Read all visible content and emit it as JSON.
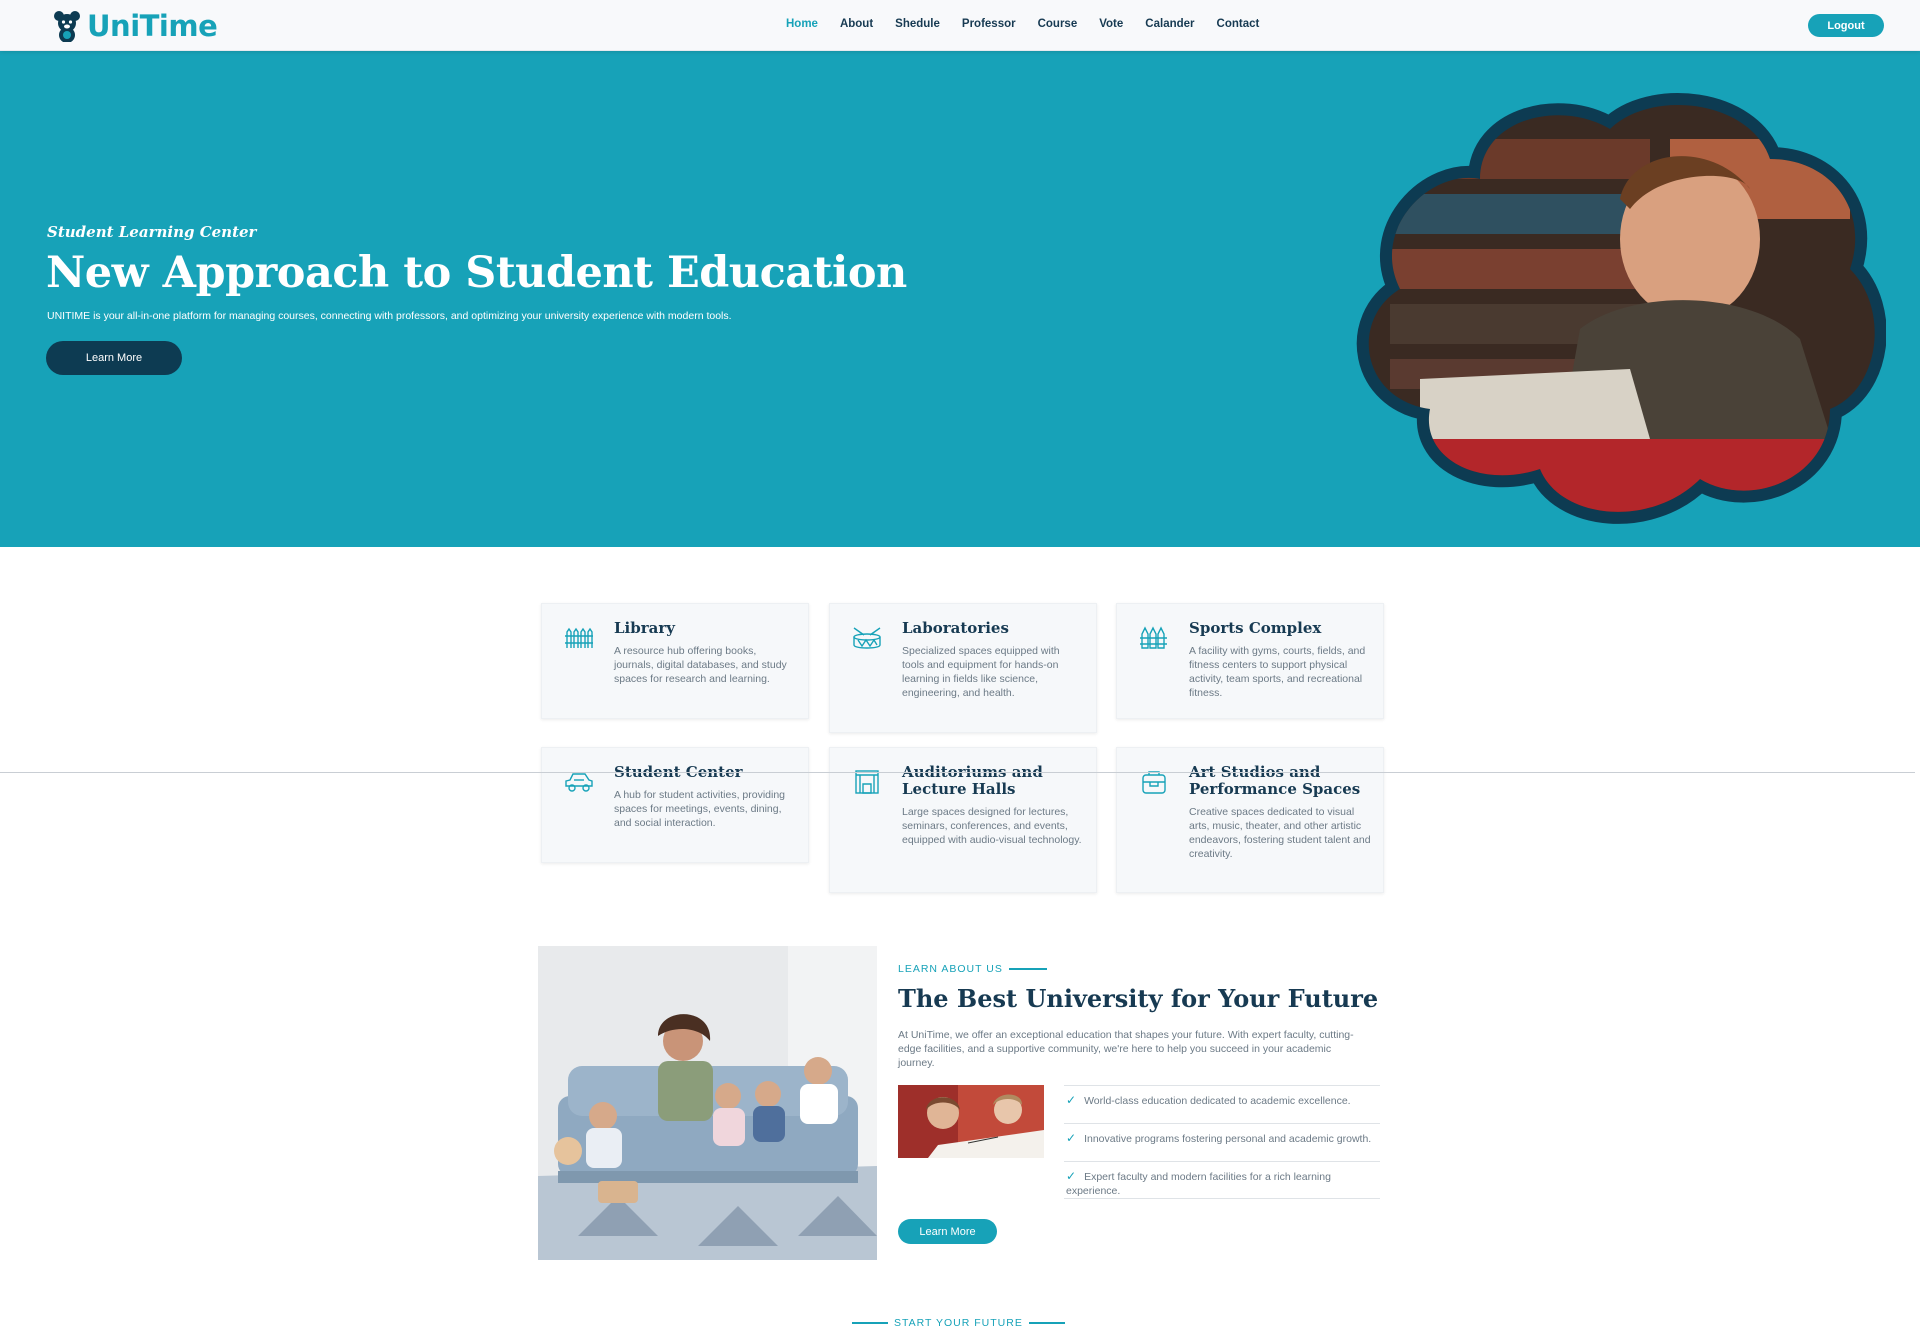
{
  "brand": {
    "name": "UniTime",
    "color": "#17a2b8",
    "dark": "#0d3b52"
  },
  "nav": {
    "items": [
      "Home",
      "About",
      "Shedule",
      "Professor",
      "Course",
      "Vote",
      "Calander",
      "Contact"
    ],
    "active": "Home",
    "logout": "Logout"
  },
  "hero": {
    "subtitle": "Student Learning Center",
    "title": "New Approach to Student Education",
    "description": "UNITIME is your all-in-one platform for managing courses, connecting with professors, and optimizing your university experience with modern tools.",
    "button": "Learn More",
    "image": "boy-reading-in-library-photo"
  },
  "facilities": [
    {
      "title": "Library",
      "icon": "fence-icon",
      "description": "A resource hub offering books, journals, digital databases, and study spaces for research and learning."
    },
    {
      "title": "Laboratories",
      "icon": "drum-icon",
      "description": "Specialized spaces equipped with tools and equipment for hands-on learning in fields like science, engineering, and health."
    },
    {
      "title": "Sports Complex",
      "icon": "crayons-icon",
      "description": "A facility with gyms, courts, fields, and fitness centers to support physical activity, team sports, and recreational fitness."
    },
    {
      "title": "Student Center",
      "icon": "toy-car-icon",
      "description": "A hub for student activities, providing spaces for meetings, events, dining, and social interaction."
    },
    {
      "title": "Auditoriums and Lecture Halls",
      "icon": "stage-icon",
      "description": "Large spaces designed for lectures, seminars, conferences, and events, equipped with audio-visual technology."
    },
    {
      "title": "Art Studios and Performance Spaces",
      "icon": "backpack-icon",
      "description": "Creative spaces dedicated to visual arts, music, theater, and other artistic endeavors, fostering student talent and creativity."
    }
  ],
  "about": {
    "eyebrow": "LEARN ABOUT US",
    "title": "The Best University for Your Future",
    "description": "At UniTime, we offer an exceptional education that shapes your future. With expert faculty, cutting-edge facilities, and a supportive community, we're here to help you succeed in your academic journey.",
    "points": [
      "World-class education dedicated to academic excellence.",
      "Innovative programs fostering personal and academic growth.",
      "Expert faculty and modern facilities for a rich learning experience."
    ],
    "button": "Learn More",
    "image": "family-on-sofa-photo",
    "small_image": "children-drawing-photo"
  },
  "future": {
    "eyebrow": "START YOUR FUTURE"
  }
}
